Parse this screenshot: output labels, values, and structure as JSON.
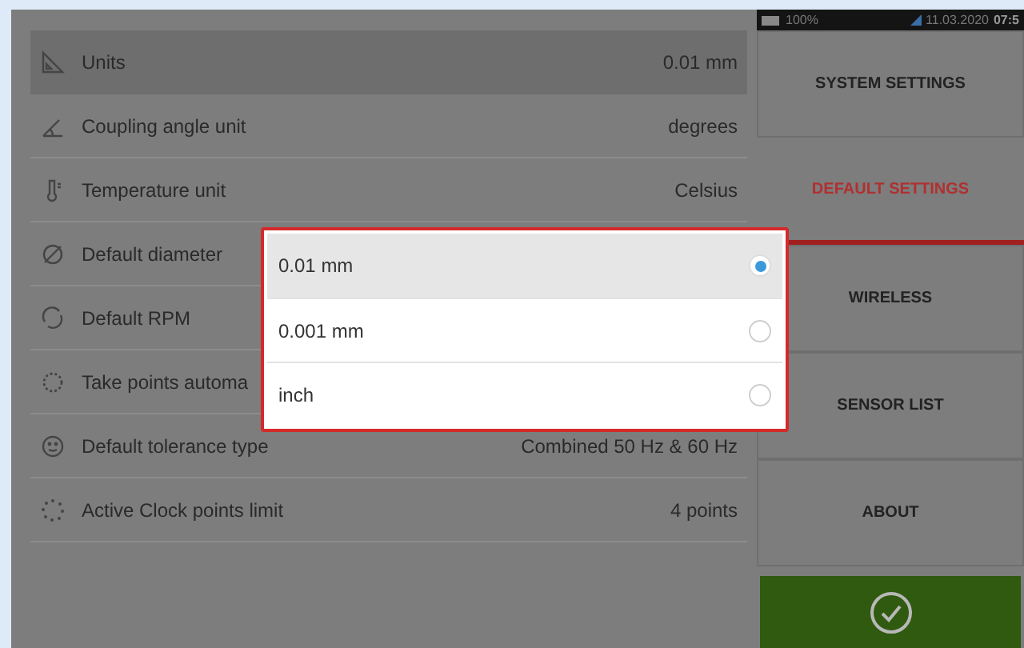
{
  "status_bar": {
    "battery": "100%",
    "date": "11.03.2020",
    "time": "07:5"
  },
  "settings": [
    {
      "label": "Units",
      "value": "0.01 mm",
      "selected": true
    },
    {
      "label": "Coupling angle unit",
      "value": "degrees",
      "selected": false
    },
    {
      "label": "Temperature unit",
      "value": "Celsius",
      "selected": false
    },
    {
      "label": "Default diameter",
      "selected": false
    },
    {
      "label": "Default RPM",
      "selected": false
    },
    {
      "label": "Take points automa",
      "selected": false
    },
    {
      "label": "Default tolerance type",
      "value": "Combined 50 Hz & 60 Hz",
      "selected": false
    },
    {
      "label": "Active Clock points limit",
      "value": "4 points",
      "selected": false
    }
  ],
  "dropdown": [
    {
      "label": "0.01 mm",
      "selected": true
    },
    {
      "label": "0.001 mm",
      "selected": false
    },
    {
      "label": "inch",
      "selected": false
    }
  ],
  "nav": [
    {
      "label": "SYSTEM SETTINGS",
      "selected": false
    },
    {
      "label": "DEFAULT SETTINGS",
      "selected": true
    },
    {
      "label": "WIRELESS",
      "selected": false
    },
    {
      "label": "SENSOR LIST",
      "selected": false
    },
    {
      "label": "ABOUT",
      "selected": false
    }
  ]
}
